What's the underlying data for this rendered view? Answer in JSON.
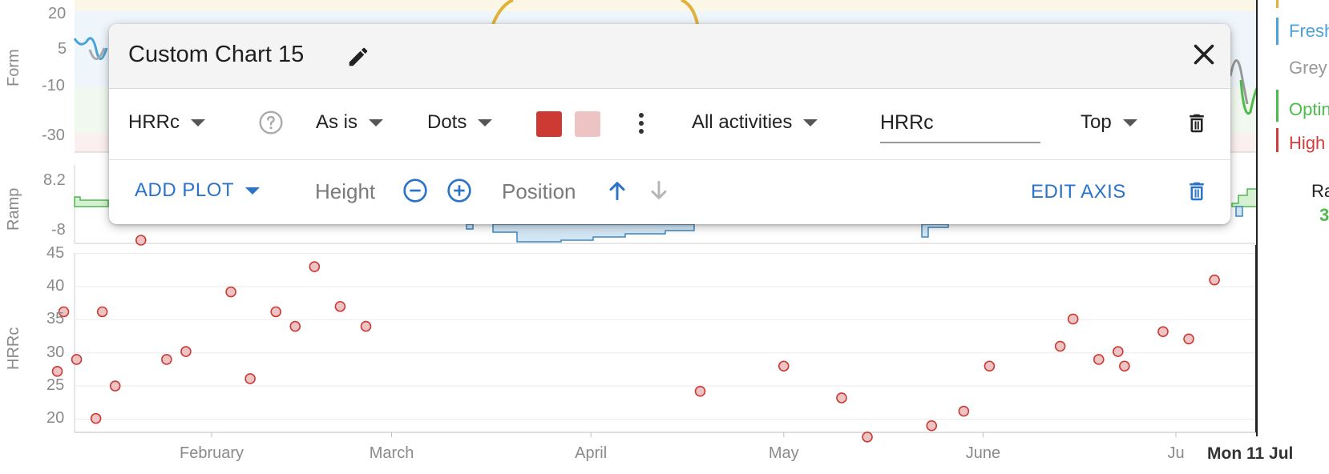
{
  "form_chart": {
    "axis_label": "Form",
    "ticks": [
      "20",
      "5",
      "-10",
      "-30"
    ]
  },
  "ramp_chart": {
    "axis_label": "Ramp",
    "ticks": [
      "8.2",
      "-8"
    ]
  },
  "legend": {
    "items": [
      {
        "label": "Fresh",
        "color": "#4aa3d8"
      },
      {
        "label": "Grey",
        "color": "#999999"
      },
      {
        "label": "Optin",
        "color": "#4cbb4c"
      },
      {
        "label": "High",
        "color": "#d13c3c"
      }
    ],
    "ramp_label": "Ra",
    "ramp_value": "3"
  },
  "popup": {
    "title": "Custom Chart 15",
    "field_dropdown": "HRRc",
    "transform_dropdown": "As is",
    "style_dropdown": "Dots",
    "color_primary": "#cc3a33",
    "color_secondary": "#eec3c3",
    "activity_filter": "All activities",
    "label_input_value": "HRRc",
    "position_dropdown": "Top",
    "add_plot_label": "ADD PLOT",
    "height_label": "Height",
    "position_label": "Position",
    "edit_axis_label": "EDIT AXIS"
  },
  "chart_data": {
    "type": "scatter",
    "title": "",
    "xlabel": "",
    "ylabel": "HRRc",
    "ylim": [
      18,
      47
    ],
    "yticks": [
      20,
      25,
      30,
      35,
      40,
      45
    ],
    "x_unit": "days since 1 Jan",
    "xticks": [
      {
        "label": "February",
        "x": 31
      },
      {
        "label": "March",
        "x": 59
      },
      {
        "label": "April",
        "x": 90
      },
      {
        "label": "May",
        "x": 120
      },
      {
        "label": "June",
        "x": 151
      },
      {
        "label": "Ju",
        "x": 181
      }
    ],
    "cursor_label": "Mon 11 Jul",
    "points": [
      {
        "x": 7,
        "y": 27.2
      },
      {
        "x": 8,
        "y": 36.2
      },
      {
        "x": 10,
        "y": 29
      },
      {
        "x": 13,
        "y": 20.1
      },
      {
        "x": 14,
        "y": 36.2
      },
      {
        "x": 16,
        "y": 25
      },
      {
        "x": 20,
        "y": 47
      },
      {
        "x": 24,
        "y": 29
      },
      {
        "x": 27,
        "y": 30.2
      },
      {
        "x": 34,
        "y": 39.2
      },
      {
        "x": 37,
        "y": 26.1
      },
      {
        "x": 41,
        "y": 36.2
      },
      {
        "x": 44,
        "y": 34
      },
      {
        "x": 47,
        "y": 43
      },
      {
        "x": 51,
        "y": 37
      },
      {
        "x": 55,
        "y": 34
      },
      {
        "x": 107,
        "y": 24.2
      },
      {
        "x": 120,
        "y": 28
      },
      {
        "x": 129,
        "y": 23.2
      },
      {
        "x": 133,
        "y": 17.3
      },
      {
        "x": 143,
        "y": 19
      },
      {
        "x": 148,
        "y": 21.2
      },
      {
        "x": 152,
        "y": 28
      },
      {
        "x": 163,
        "y": 31
      },
      {
        "x": 165,
        "y": 35.1
      },
      {
        "x": 169,
        "y": 29
      },
      {
        "x": 172,
        "y": 30.2
      },
      {
        "x": 173,
        "y": 28
      },
      {
        "x": 179,
        "y": 33.2
      },
      {
        "x": 183,
        "y": 32.1
      },
      {
        "x": 187,
        "y": 41
      }
    ],
    "marker_fill": "#eec3c3",
    "marker_stroke": "#cc3a33"
  }
}
